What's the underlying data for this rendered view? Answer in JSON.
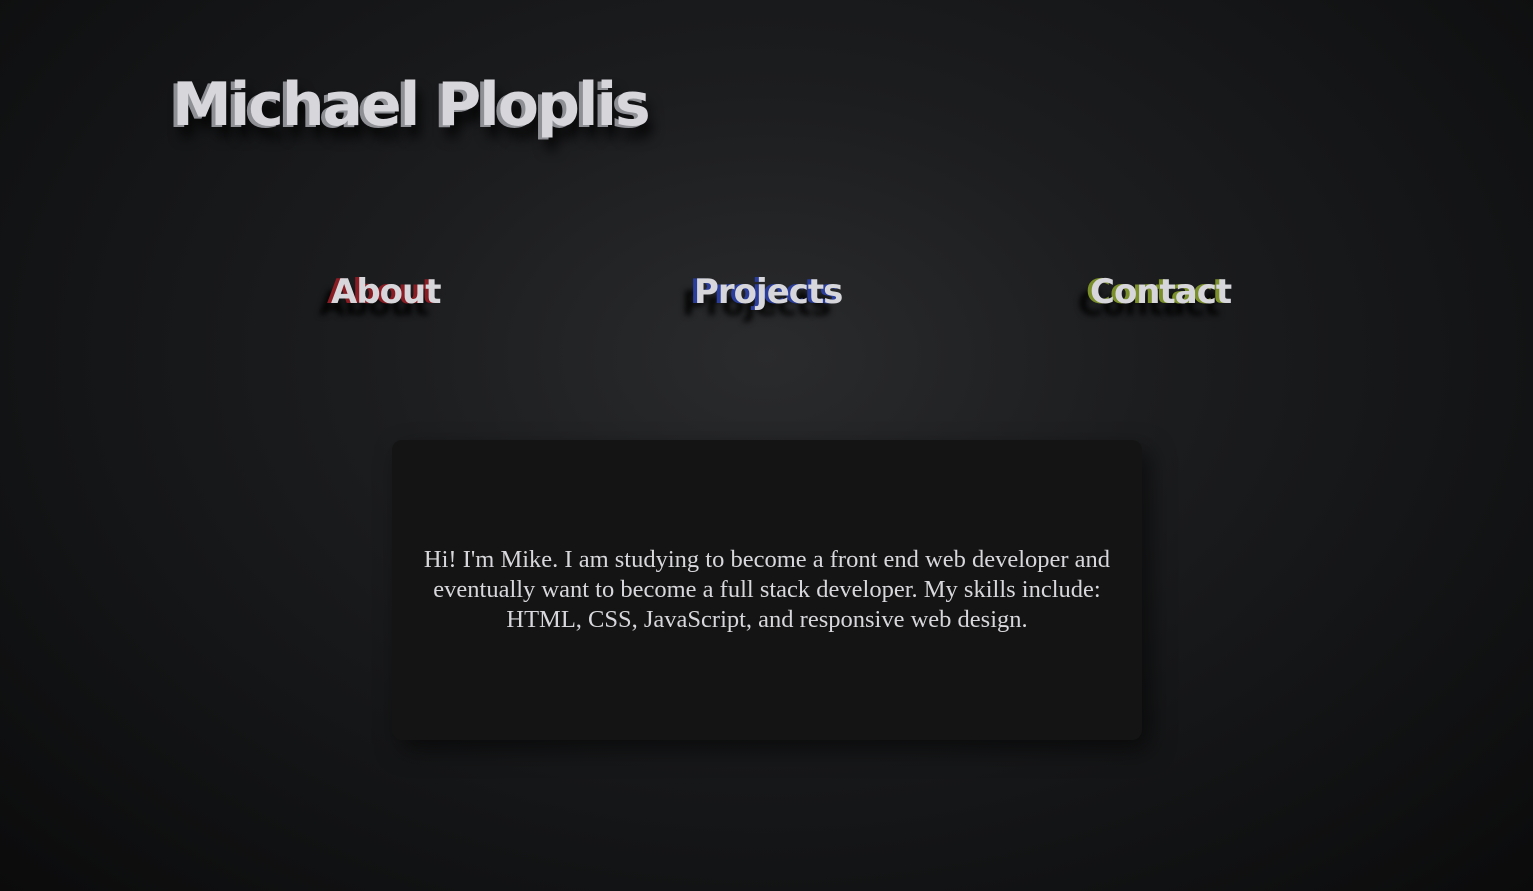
{
  "header": {
    "title": "Michael Ploplis"
  },
  "nav": {
    "items": [
      {
        "label": "About",
        "accent": "#8a1c24"
      },
      {
        "label": "Projects",
        "accent": "#2a3d9a"
      },
      {
        "label": "Contact",
        "accent": "#7b8f2a"
      }
    ]
  },
  "about": {
    "text": "Hi! I'm Mike. I am studying to become a front end web developer and eventually want to become a full stack developer. My skills include: HTML, CSS, JavaScript, and responsive web design."
  },
  "colors": {
    "background": "#1c1d1f",
    "card": "#141414",
    "text": "#d6d6db"
  }
}
